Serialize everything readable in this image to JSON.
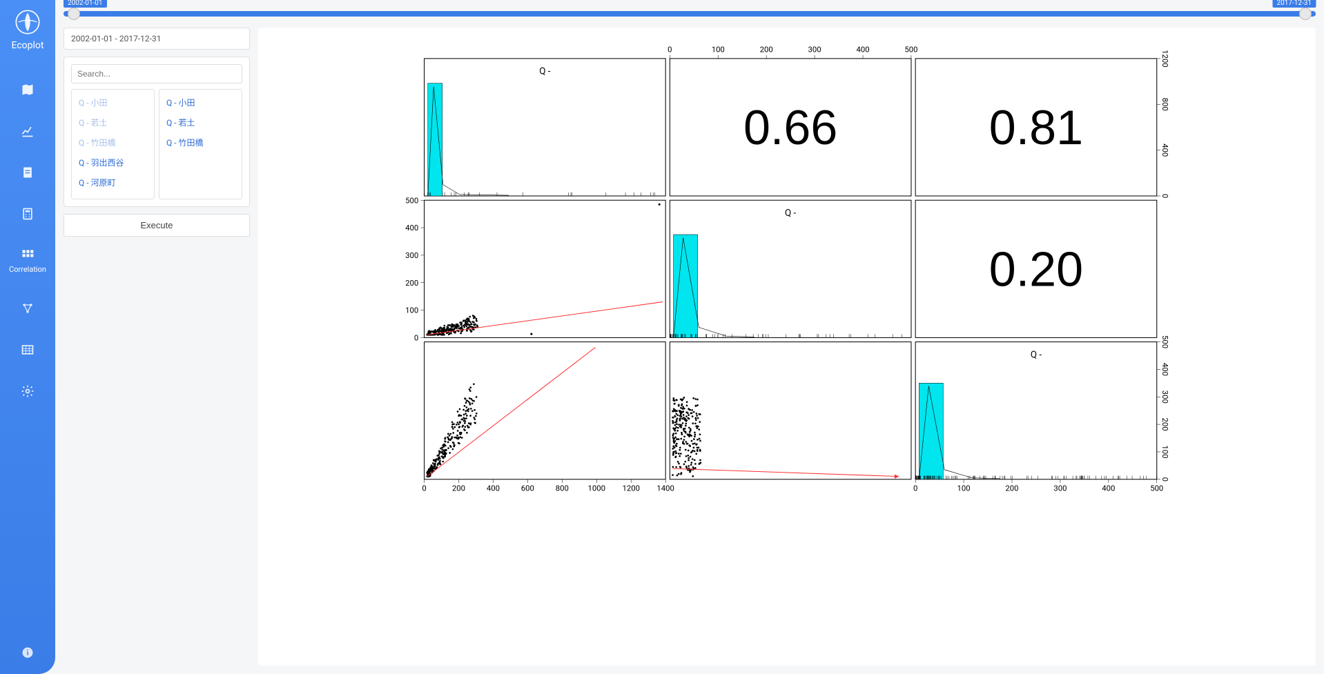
{
  "brand": {
    "name": "Ecoplot"
  },
  "sidebar": {
    "items": [
      {
        "key": "map",
        "label": "Map"
      },
      {
        "key": "timeseries",
        "label": "Chart"
      },
      {
        "key": "report",
        "label": "Report"
      },
      {
        "key": "calc",
        "label": "Calc"
      },
      {
        "key": "correlation",
        "label": "Correlation"
      },
      {
        "key": "network",
        "label": "Network"
      },
      {
        "key": "table",
        "label": "Table"
      },
      {
        "key": "settings",
        "label": "Settings"
      }
    ],
    "active_key": "correlation"
  },
  "timeline": {
    "start_label": "2002-01-01",
    "end_label": "2017-12-31"
  },
  "panel": {
    "date_range_text": "2002-01-01 - 2017-12-31",
    "search_placeholder": "Search...",
    "available_items": [
      "Q - 小田",
      "Q - 若土",
      "Q - 竹田橋",
      "Q - 羽出西谷",
      "Q - 河原町"
    ],
    "selected_items": [
      "Q - 小田",
      "Q - 若土",
      "Q - 竹田橋"
    ],
    "dimmed_available": [
      "Q - 小田",
      "Q - 若土",
      "Q - 竹田橋"
    ],
    "execute_label": "Execute"
  },
  "chart_data": {
    "type": "correlation-pairs-matrix",
    "variables": [
      "Q -",
      "Q -",
      "Q -"
    ],
    "correlations": {
      "r12": 0.66,
      "r13": 0.81,
      "r23": 0.2
    },
    "axes": {
      "var1": {
        "min": 0,
        "max": 1400,
        "breaks": [
          0,
          200,
          400,
          600,
          800,
          1000,
          1200,
          1400
        ]
      },
      "var2": {
        "min": 0,
        "max": 500,
        "breaks": [
          0,
          100,
          200,
          300,
          400,
          500
        ]
      },
      "var3": {
        "min": 0,
        "max": 500,
        "breaks": [
          0,
          100,
          200,
          300,
          400,
          500
        ]
      },
      "right_row1": {
        "min": 0,
        "max": 1200,
        "breaks": [
          0,
          400,
          800,
          1200
        ]
      },
      "right_row3": {
        "min": 0,
        "max": 500,
        "breaks": [
          0,
          100,
          200,
          300,
          400,
          500
        ]
      }
    },
    "histograms": {
      "var1": {
        "range": [
          0,
          1400
        ],
        "barWidthFrac": 0.06,
        "heightFrac": 0.82,
        "rugDensity": "sparse"
      },
      "var2": {
        "range": [
          0,
          500
        ],
        "barWidthFrac": 0.1,
        "heightFrac": 0.75,
        "rugDensity": "medium"
      },
      "var3": {
        "range": [
          0,
          500
        ],
        "barWidthFrac": 0.1,
        "heightFrac": 0.7,
        "rugDensity": "dense"
      }
    },
    "scatter": {
      "c21": {
        "xrange": [
          0,
          1400
        ],
        "yrange": [
          0,
          500
        ],
        "trend": [
          [
            0,
            0
          ],
          [
            1400,
            125
          ]
        ],
        "cluster": {
          "x": [
            0,
            300
          ],
          "y": [
            0,
            100
          ]
        },
        "outliers": [
          [
            1380,
            495
          ],
          [
            620,
            3
          ]
        ]
      },
      "c31": {
        "xrange": [
          0,
          1400
        ],
        "yrange": [
          0,
          500
        ],
        "trend": [
          [
            0,
            0
          ],
          [
            1000,
            490
          ]
        ],
        "cluster": {
          "x": [
            0,
            300
          ],
          "y": [
            0,
            300
          ]
        },
        "outliers": []
      },
      "c32": {
        "xrange": [
          0,
          500
        ],
        "yrange": [
          0,
          500
        ],
        "trend": [
          [
            0,
            30
          ],
          [
            480,
            0
          ]
        ],
        "cluster": {
          "x": [
            0,
            60
          ],
          "y": [
            0,
            300
          ]
        },
        "outliers": []
      }
    }
  }
}
